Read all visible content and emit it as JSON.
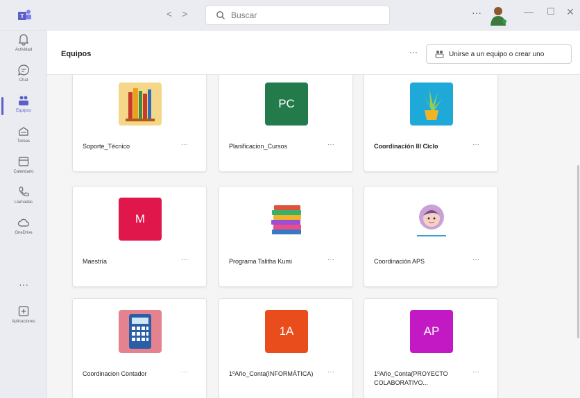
{
  "titlebar": {
    "search_placeholder": "Buscar",
    "more": "···",
    "minimize": "—",
    "maximize": "☐",
    "close": "✕",
    "nav_back": "<",
    "nav_forward": ">"
  },
  "rail": {
    "items": [
      {
        "label": "Actividad",
        "icon": "bell-icon"
      },
      {
        "label": "Chat",
        "icon": "chat-icon"
      },
      {
        "label": "Equipos",
        "icon": "teams-icon"
      },
      {
        "label": "Tareas",
        "icon": "assignments-icon"
      },
      {
        "label": "Calendario",
        "icon": "calendar-icon"
      },
      {
        "label": "Llamadas",
        "icon": "phone-icon"
      },
      {
        "label": "OneDrive",
        "icon": "cloud-icon"
      },
      {
        "label": "Aplicaciones",
        "icon": "apps-icon"
      }
    ],
    "more": "···",
    "active_color": "#5b5fc7"
  },
  "header": {
    "title": "Equipos",
    "more": "···",
    "join_label": "Unirse a un equipo o crear uno"
  },
  "teams": [
    {
      "name": "Soporte_Técnico",
      "thumb": "books-image",
      "bold": false
    },
    {
      "name": "Planificacion_Cursos",
      "thumb": "initials",
      "initials": "PC",
      "color": "#237b4b",
      "bold": false
    },
    {
      "name": "Coordinación III Ciclo",
      "thumb": "plant-image",
      "bold": true
    },
    {
      "name": "Maestría",
      "thumb": "initials",
      "initials": "M",
      "color": "#e0174a",
      "bold": false
    },
    {
      "name": "Programa Talitha Kumi",
      "thumb": "book-stack-image",
      "bold": false
    },
    {
      "name": "Coordinación APS",
      "thumb": "girl-image",
      "bold": false
    },
    {
      "name": "Coordinacion Contador",
      "thumb": "calculator-image",
      "bold": false
    },
    {
      "name": "1ºAño_Conta(INFORMÁTICA)",
      "thumb": "initials",
      "initials": "1A",
      "color": "#e94d1c",
      "bold": false
    },
    {
      "name": "1ºAño_Conta(PROYECTO COLABORATIVO...",
      "thumb": "initials",
      "initials": "AP",
      "color": "#c219c4",
      "bold": false
    }
  ],
  "card_more": "···"
}
